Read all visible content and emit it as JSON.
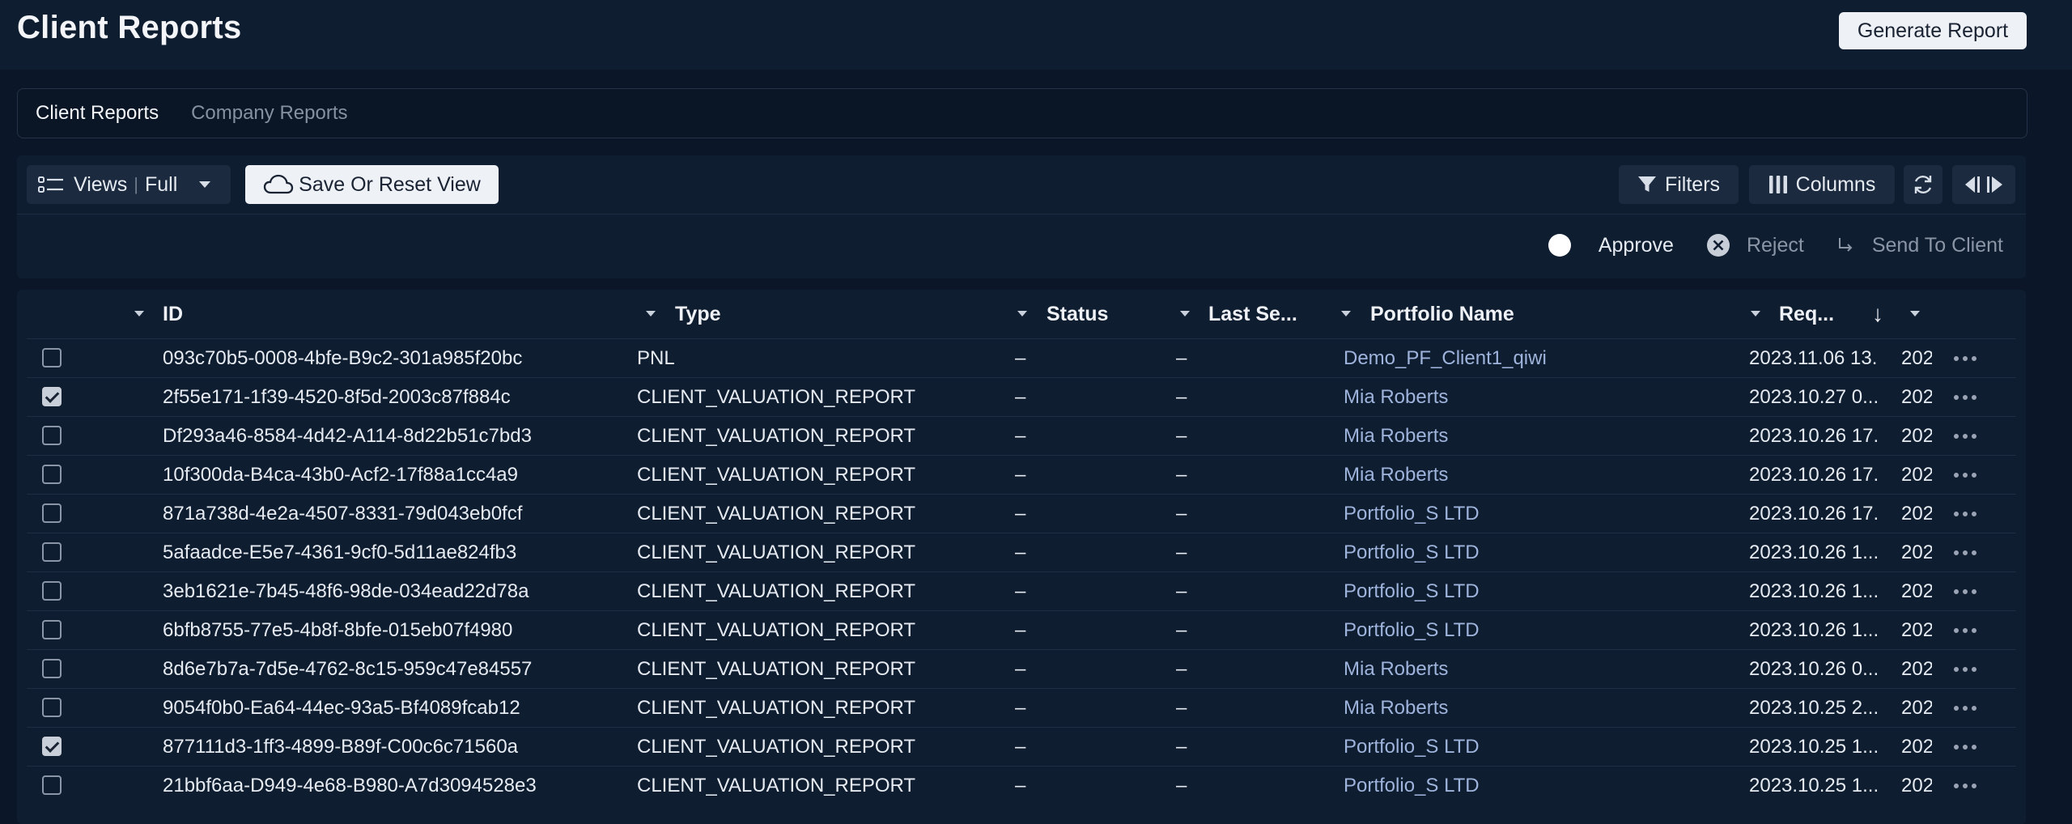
{
  "header": {
    "title": "Client Reports",
    "generate_label": "Generate Report"
  },
  "tabs": [
    {
      "label": "Client Reports",
      "active": true
    },
    {
      "label": "Company Reports",
      "active": false
    }
  ],
  "toolbar": {
    "views_label": "Views",
    "views_separator": "|",
    "views_value": "Full",
    "save_label": "Save Or Reset View",
    "filters_label": "Filters",
    "columns_label": "Columns"
  },
  "actions": {
    "approve": "Approve",
    "reject": "Reject",
    "send": "Send To Client"
  },
  "table": {
    "headers": {
      "id": "ID",
      "type": "Type",
      "status": "Status",
      "last_sent": "Last Se...",
      "portfolio": "Portfolio Name",
      "requested": "Req..."
    },
    "sort_indicator": "↓",
    "rows": [
      {
        "checked": false,
        "id": "093c70b5-0008-4bfe-B9c2-301a985f20bc",
        "type": "PNL",
        "status": "–",
        "last_sent": "–",
        "portfolio": "Demo_PF_Client1_qiwi",
        "requested": "2023.11.06 13...",
        "extra": "202"
      },
      {
        "checked": true,
        "id": "2f55e171-1f39-4520-8f5d-2003c87f884c",
        "type": "CLIENT_VALUATION_REPORT",
        "status": "–",
        "last_sent": "–",
        "portfolio": "Mia Roberts",
        "requested": "2023.10.27 0...",
        "extra": "202"
      },
      {
        "checked": false,
        "id": "Df293a46-8584-4d42-A114-8d22b51c7bd3",
        "type": "CLIENT_VALUATION_REPORT",
        "status": "–",
        "last_sent": "–",
        "portfolio": "Mia Roberts",
        "requested": "2023.10.26 17...",
        "extra": "202"
      },
      {
        "checked": false,
        "id": "10f300da-B4ca-43b0-Acf2-17f88a1cc4a9",
        "type": "CLIENT_VALUATION_REPORT",
        "status": "–",
        "last_sent": "–",
        "portfolio": "Mia Roberts",
        "requested": "2023.10.26 17...",
        "extra": "202"
      },
      {
        "checked": false,
        "id": "871a738d-4e2a-4507-8331-79d043eb0fcf",
        "type": "CLIENT_VALUATION_REPORT",
        "status": "–",
        "last_sent": "–",
        "portfolio": "Portfolio_S LTD",
        "requested": "2023.10.26 17...",
        "extra": "202"
      },
      {
        "checked": false,
        "id": "5afaadce-E5e7-4361-9cf0-5d11ae824fb3",
        "type": "CLIENT_VALUATION_REPORT",
        "status": "–",
        "last_sent": "–",
        "portfolio": "Portfolio_S LTD",
        "requested": "2023.10.26 1...",
        "extra": "202"
      },
      {
        "checked": false,
        "id": "3eb1621e-7b45-48f6-98de-034ead22d78a",
        "type": "CLIENT_VALUATION_REPORT",
        "status": "–",
        "last_sent": "–",
        "portfolio": "Portfolio_S LTD",
        "requested": "2023.10.26 1...",
        "extra": "202"
      },
      {
        "checked": false,
        "id": "6bfb8755-77e5-4b8f-8bfe-015eb07f4980",
        "type": "CLIENT_VALUATION_REPORT",
        "status": "–",
        "last_sent": "–",
        "portfolio": "Portfolio_S LTD",
        "requested": "2023.10.26 1...",
        "extra": "202"
      },
      {
        "checked": false,
        "id": "8d6e7b7a-7d5e-4762-8c15-959c47e84557",
        "type": "CLIENT_VALUATION_REPORT",
        "status": "–",
        "last_sent": "–",
        "portfolio": "Mia Roberts",
        "requested": "2023.10.26 0...",
        "extra": "202"
      },
      {
        "checked": false,
        "id": "9054f0b0-Ea64-44ec-93a5-Bf4089fcab12",
        "type": "CLIENT_VALUATION_REPORT",
        "status": "–",
        "last_sent": "–",
        "portfolio": "Mia Roberts",
        "requested": "2023.10.25 2...",
        "extra": "202"
      },
      {
        "checked": true,
        "id": "877111d3-1ff3-4899-B89f-C00c6c71560a",
        "type": "CLIENT_VALUATION_REPORT",
        "status": "–",
        "last_sent": "–",
        "portfolio": "Portfolio_S LTD",
        "requested": "2023.10.25 1...",
        "extra": "202"
      },
      {
        "checked": false,
        "id": "21bbf6aa-D949-4e68-B980-A7d3094528e3",
        "type": "CLIENT_VALUATION_REPORT",
        "status": "–",
        "last_sent": "–",
        "portfolio": "Portfolio_S LTD",
        "requested": "2023.10.25 1...",
        "extra": "202"
      }
    ]
  },
  "colors": {
    "background": "#0b1728",
    "panel": "#0f1d30",
    "link": "#9fb4dc",
    "button_light": "#eef1f6"
  },
  "icons": [
    "list-icon",
    "caret-down-icon",
    "cloud-icon",
    "filter-icon",
    "columns-icon",
    "refresh-icon",
    "collapse-icon",
    "approve-radio-icon",
    "reject-icon",
    "send-arrow-icon",
    "sort-arrow-icon",
    "more-icon"
  ]
}
